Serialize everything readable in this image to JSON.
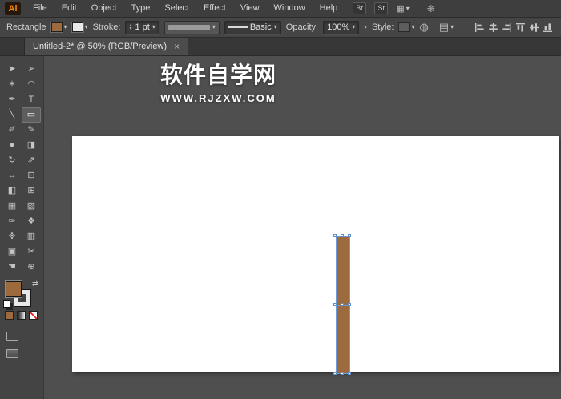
{
  "menubar": {
    "logo": "Ai",
    "items": [
      "File",
      "Edit",
      "Object",
      "Type",
      "Select",
      "Effect",
      "View",
      "Window",
      "Help"
    ],
    "br_button": "Br",
    "st_button": "St"
  },
  "icons": {
    "arrange_documents": "▦",
    "chevron_down": "▾",
    "cs_live": "❋",
    "stepper_up": "▴",
    "stepper_down": "▾",
    "recolor_artwork": "◍",
    "document_setup": "▤",
    "panel_arrow": "›",
    "close": "×",
    "swap_arrows": "⇄"
  },
  "controlbar": {
    "tool_name": "Rectangle",
    "stroke_label": "Stroke:",
    "stroke_weight": "1 pt",
    "brush_name": "Basic",
    "opacity_label": "Opacity:",
    "opacity_value": "100%",
    "style_label": "Style:"
  },
  "tabbar": {
    "active_tab": "Untitled-2* @ 50% (RGB/Preview)"
  },
  "toolbar": {
    "tools": [
      {
        "name": "selection-tool",
        "glyph": "➤"
      },
      {
        "name": "direct-selection-tool",
        "glyph": "➢"
      },
      {
        "name": "magic-wand-tool",
        "glyph": "✶"
      },
      {
        "name": "lasso-tool",
        "glyph": "◠"
      },
      {
        "name": "pen-tool",
        "glyph": "✒"
      },
      {
        "name": "type-tool",
        "glyph": "T"
      },
      {
        "name": "line-segment-tool",
        "glyph": "╲"
      },
      {
        "name": "rectangle-tool",
        "glyph": "▭",
        "selected": true
      },
      {
        "name": "paintbrush-tool",
        "glyph": "✐"
      },
      {
        "name": "pencil-tool",
        "glyph": "✎"
      },
      {
        "name": "blob-brush-tool",
        "glyph": "●"
      },
      {
        "name": "eraser-tool",
        "glyph": "◨"
      },
      {
        "name": "rotate-tool",
        "glyph": "↻"
      },
      {
        "name": "scale-tool",
        "glyph": "⇗"
      },
      {
        "name": "width-tool",
        "glyph": "↔"
      },
      {
        "name": "free-transform-tool",
        "glyph": "⊡"
      },
      {
        "name": "shape-builder-tool",
        "glyph": "◧"
      },
      {
        "name": "perspective-grid-tool",
        "glyph": "⊞"
      },
      {
        "name": "mesh-tool",
        "glyph": "▦"
      },
      {
        "name": "gradient-tool",
        "glyph": "▨"
      },
      {
        "name": "eyedropper-tool",
        "glyph": "✑"
      },
      {
        "name": "blend-tool",
        "glyph": "❖"
      },
      {
        "name": "symbol-sprayer-tool",
        "glyph": "❉"
      },
      {
        "name": "column-graph-tool",
        "glyph": "▥"
      },
      {
        "name": "artboard-tool",
        "glyph": "▣"
      },
      {
        "name": "slice-tool",
        "glyph": "✂"
      },
      {
        "name": "hand-tool",
        "glyph": "☚"
      },
      {
        "name": "zoom-tool",
        "glyph": "⊕"
      }
    ]
  },
  "watermark": {
    "title": "软件自学网",
    "url": "WWW.RJZXW.COM"
  },
  "colors": {
    "fill_brown": "#9c6a3c",
    "selection_blue": "#6d99d6",
    "logo_orange": "#ff8a00",
    "artboard_white": "#ffffff",
    "ui_dark": "#3e3e3e",
    "canvas_gray": "#4f4f4f"
  }
}
